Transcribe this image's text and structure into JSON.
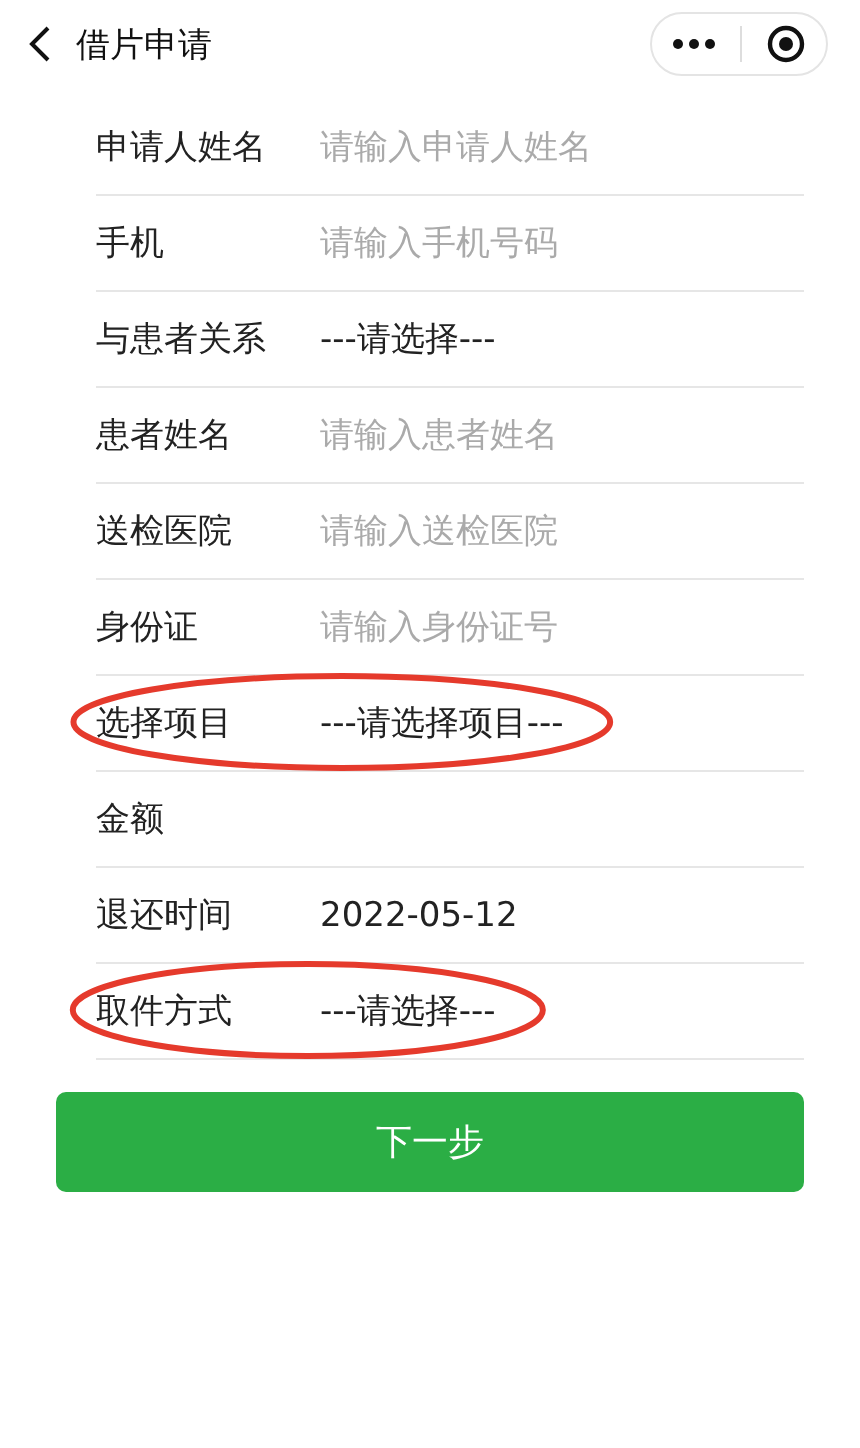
{
  "header": {
    "title": "借片申请"
  },
  "fields": [
    {
      "label": "申请人姓名",
      "kind": "input",
      "placeholder": "请输入申请人姓名",
      "circled": false
    },
    {
      "label": "手机",
      "kind": "input",
      "placeholder": "请输入手机号码",
      "circled": false
    },
    {
      "label": "与患者关系",
      "kind": "select",
      "value": "---请选择---",
      "circled": false
    },
    {
      "label": "患者姓名",
      "kind": "input",
      "placeholder": "请输入患者姓名",
      "circled": false
    },
    {
      "label": "送检医院",
      "kind": "input",
      "placeholder": "请输入送检医院",
      "circled": false
    },
    {
      "label": "身份证",
      "kind": "input",
      "placeholder": "请输入身份证号",
      "circled": false
    },
    {
      "label": "选择项目",
      "kind": "select",
      "value": "---请选择项目---",
      "circled": true
    },
    {
      "label": "金额",
      "kind": "static",
      "circled": false
    },
    {
      "label": "退还时间",
      "kind": "select",
      "value": "2022-05-12",
      "circled": false
    },
    {
      "label": "取件方式",
      "kind": "select",
      "value": "---请选择---",
      "circled": true
    }
  ],
  "submit": {
    "label": "下一步"
  }
}
